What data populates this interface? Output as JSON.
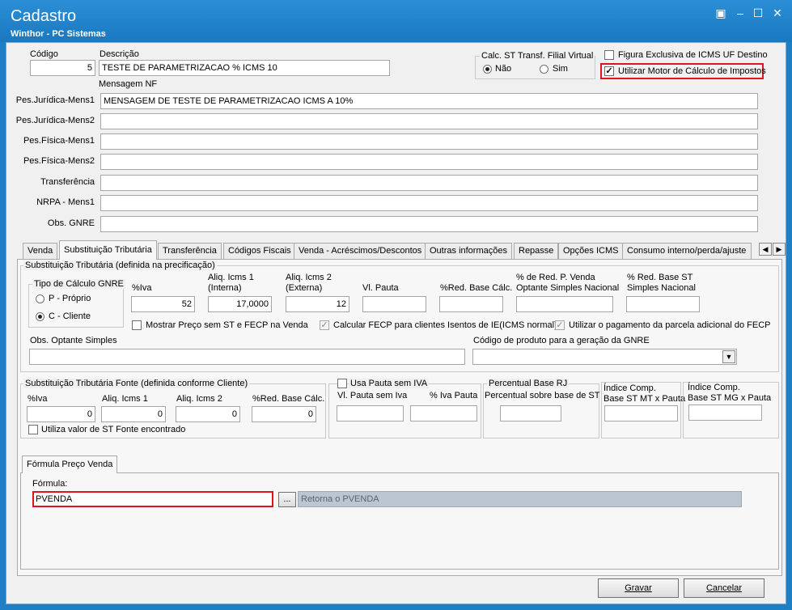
{
  "window": {
    "title": "Cadastro",
    "subtitle": "Winthor - PC Sistemas"
  },
  "header": {
    "codigo_label": "Código",
    "codigo_value": "5",
    "descricao_label": "Descrição",
    "descricao_value": "TESTE DE PARAMETRIZACAO % ICMS 10",
    "calc_st": {
      "title": "Calc. ST Transf. Filial Virtual",
      "options": [
        "Não",
        "Sim"
      ],
      "selected": "Não"
    },
    "figura_label": "Figura Exclusiva de ICMS UF Destino",
    "motor_label": "Utilizar Motor de Cálculo de Impostos",
    "mensagem_label": "Mensagem NF"
  },
  "messages": [
    {
      "label": "Pes.Jurídica-Mens1",
      "value": "MENSAGEM DE TESTE DE PARAMETRIZACAO ICMS A 10%"
    },
    {
      "label": "Pes.Jurídica-Mens2",
      "value": ""
    },
    {
      "label": "Pes.Física-Mens1",
      "value": ""
    },
    {
      "label": "Pes.Física-Mens2",
      "value": ""
    },
    {
      "label": "Transferência",
      "value": ""
    },
    {
      "label": "NRPA - Mens1",
      "value": ""
    },
    {
      "label": "Obs. GNRE",
      "value": ""
    }
  ],
  "tabs": [
    "Venda",
    "Substituição Tributária",
    "Transferência",
    "Códigos Fiscais",
    "Venda - Acréscimos/Descontos",
    "Outras informações",
    "Repasse",
    "Opções ICMS",
    "Consumo interno/perda/ajuste"
  ],
  "active_tab": "Substituição Tributária",
  "st": {
    "group_title": "Substituição Tributária (definida na precificação)",
    "tipo": {
      "title": "Tipo de Cálculo GNRE",
      "options": [
        "P - Próprio",
        "C - Cliente"
      ],
      "selected": "C - Cliente"
    },
    "iva": {
      "label": "%Iva",
      "value": "52"
    },
    "aliq1": {
      "label1": "Aliq. Icms 1",
      "label2": "(Interna)",
      "value": "17,0000"
    },
    "aliq2": {
      "label1": "Aliq. Icms 2",
      "label2": "(Externa)",
      "value": "12"
    },
    "pauta": {
      "label": "Vl. Pauta",
      "value": ""
    },
    "red_base": {
      "label": "%Red. Base Cálc.",
      "value": ""
    },
    "red_venda": {
      "label1": "% de Red. P. Venda",
      "label2": "Optante Simples Nacional",
      "value": ""
    },
    "red_st": {
      "label1": "% Red. Base ST",
      "label2": "Simples Nacional",
      "value": ""
    },
    "mostrar_label": "Mostrar Preço sem ST e FECP na Venda",
    "calcular_label": "Calcular FECP para clientes Isentos de IE(ICMS normal)",
    "utilizar_fecp_label": "Utilizar o pagamento da parcela adicional do FECP",
    "obs_label": "Obs. Optante Simples",
    "obs_value": "",
    "codigo_label": "Código de produto para a geração da GNRE",
    "codigo_value": ""
  },
  "fonte": {
    "group_title": "Substituição Tributária Fonte (definida conforme Cliente)",
    "iva": {
      "label": "%Iva",
      "value": "0"
    },
    "aliq1": {
      "label": "Aliq. Icms 1",
      "value": "0"
    },
    "aliq2": {
      "label": "Aliq. Icms 2",
      "value": "0"
    },
    "red": {
      "label": "%Red. Base Cálc.",
      "value": "0"
    },
    "utiliza_label": "Utiliza valor de ST Fonte encontrado"
  },
  "pauta": {
    "title": "Usa Pauta sem IVA",
    "vl_label": "Vl. Pauta sem Iva",
    "iva_label": "% Iva Pauta"
  },
  "base_rj": {
    "title": "Percentual Base RJ",
    "label": "Percentual sobre base de ST"
  },
  "indice_mt": {
    "label1": "Índice Comp.",
    "label2": "Base ST MT x Pauta"
  },
  "indice_mg": {
    "label1": "Índice Comp.",
    "label2": "Base ST MG x Pauta"
  },
  "formula": {
    "tab": "Fórmula Preço Venda",
    "label": "Fórmula:",
    "value": "PVENDA",
    "browse": "...",
    "result": "Retorna o PVENDA"
  },
  "buttons": {
    "gravar": "Gravar",
    "cancelar": "Cancelar"
  }
}
